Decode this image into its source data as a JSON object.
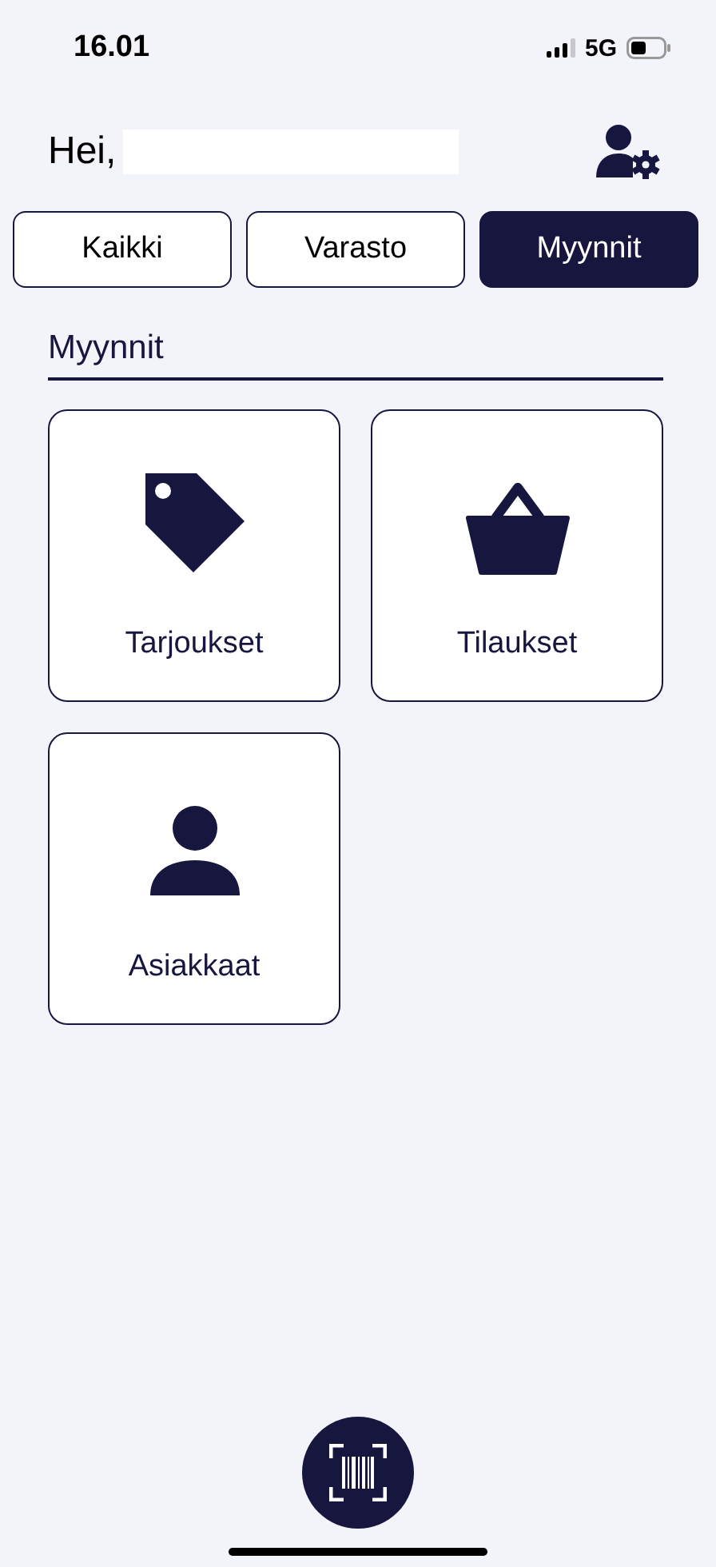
{
  "status_bar": {
    "time": "16.01",
    "network": "5G"
  },
  "header": {
    "greeting": "Hei,"
  },
  "tabs": [
    {
      "label": "Kaikki",
      "selected": false
    },
    {
      "label": "Varasto",
      "selected": false
    },
    {
      "label": "Myynnit",
      "selected": true
    }
  ],
  "section": {
    "title": "Myynnit"
  },
  "tiles": [
    {
      "label": "Tarjoukset",
      "kind": "tag"
    },
    {
      "label": "Tilaukset",
      "kind": "basket"
    },
    {
      "label": "Asiakkaat",
      "kind": "person"
    }
  ]
}
